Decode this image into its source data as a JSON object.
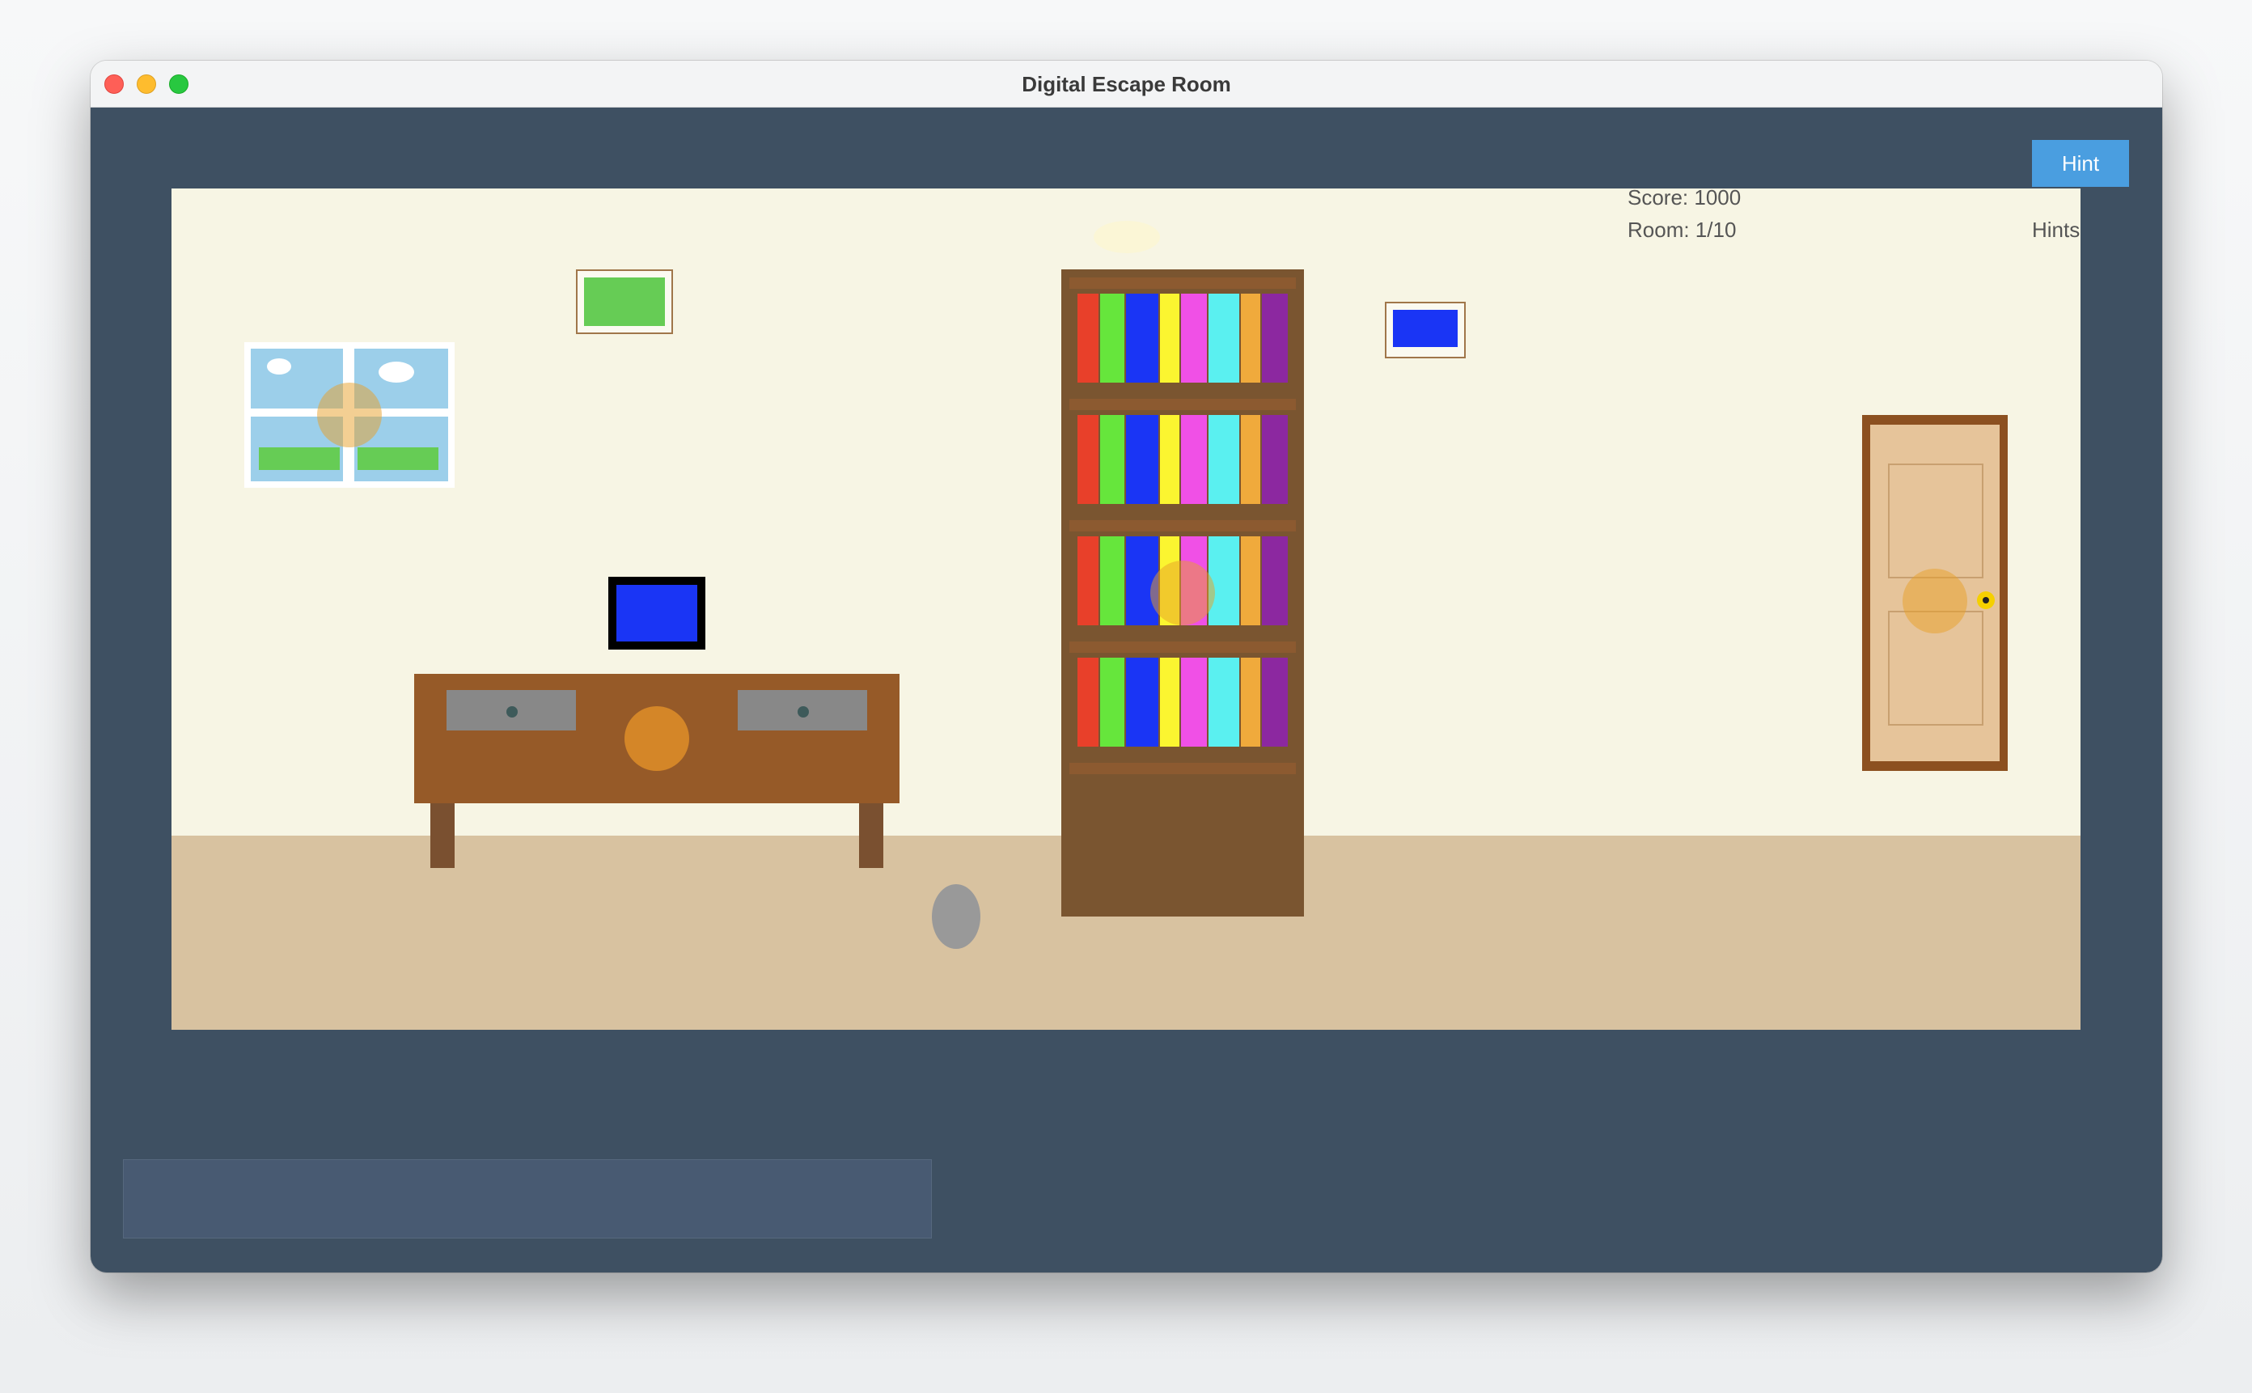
{
  "window": {
    "title": "Digital Escape Room"
  },
  "toolbar": {
    "hint_label": "Hint"
  },
  "hud": {
    "score": "Score: 1000",
    "room": "Room: 1/10",
    "hints": "Hints"
  },
  "message": {
    "text": ""
  },
  "colors": {
    "background": "#3e5062",
    "wall": "#f7f5e4",
    "floor": "#d8c2a0",
    "accent": "#4a9ee0",
    "hotspot": "#e8a028"
  },
  "scene": {
    "objects": [
      "window",
      "green-picture",
      "blue-picture",
      "computer",
      "desk",
      "bookshelf",
      "rock",
      "door",
      "ceiling-lamp"
    ],
    "bookshelf": {
      "shelves": 4,
      "book_colors": [
        "#e8402a",
        "#66e63c",
        "#1a35f5",
        "#fbf530",
        "#f050e6",
        "#5af0f0",
        "#f0aa3c",
        "#8c28a0"
      ]
    },
    "hotspots": [
      "window-hotspot",
      "desk-hotspot",
      "bookshelf-hotspot",
      "door-hotspot"
    ]
  }
}
